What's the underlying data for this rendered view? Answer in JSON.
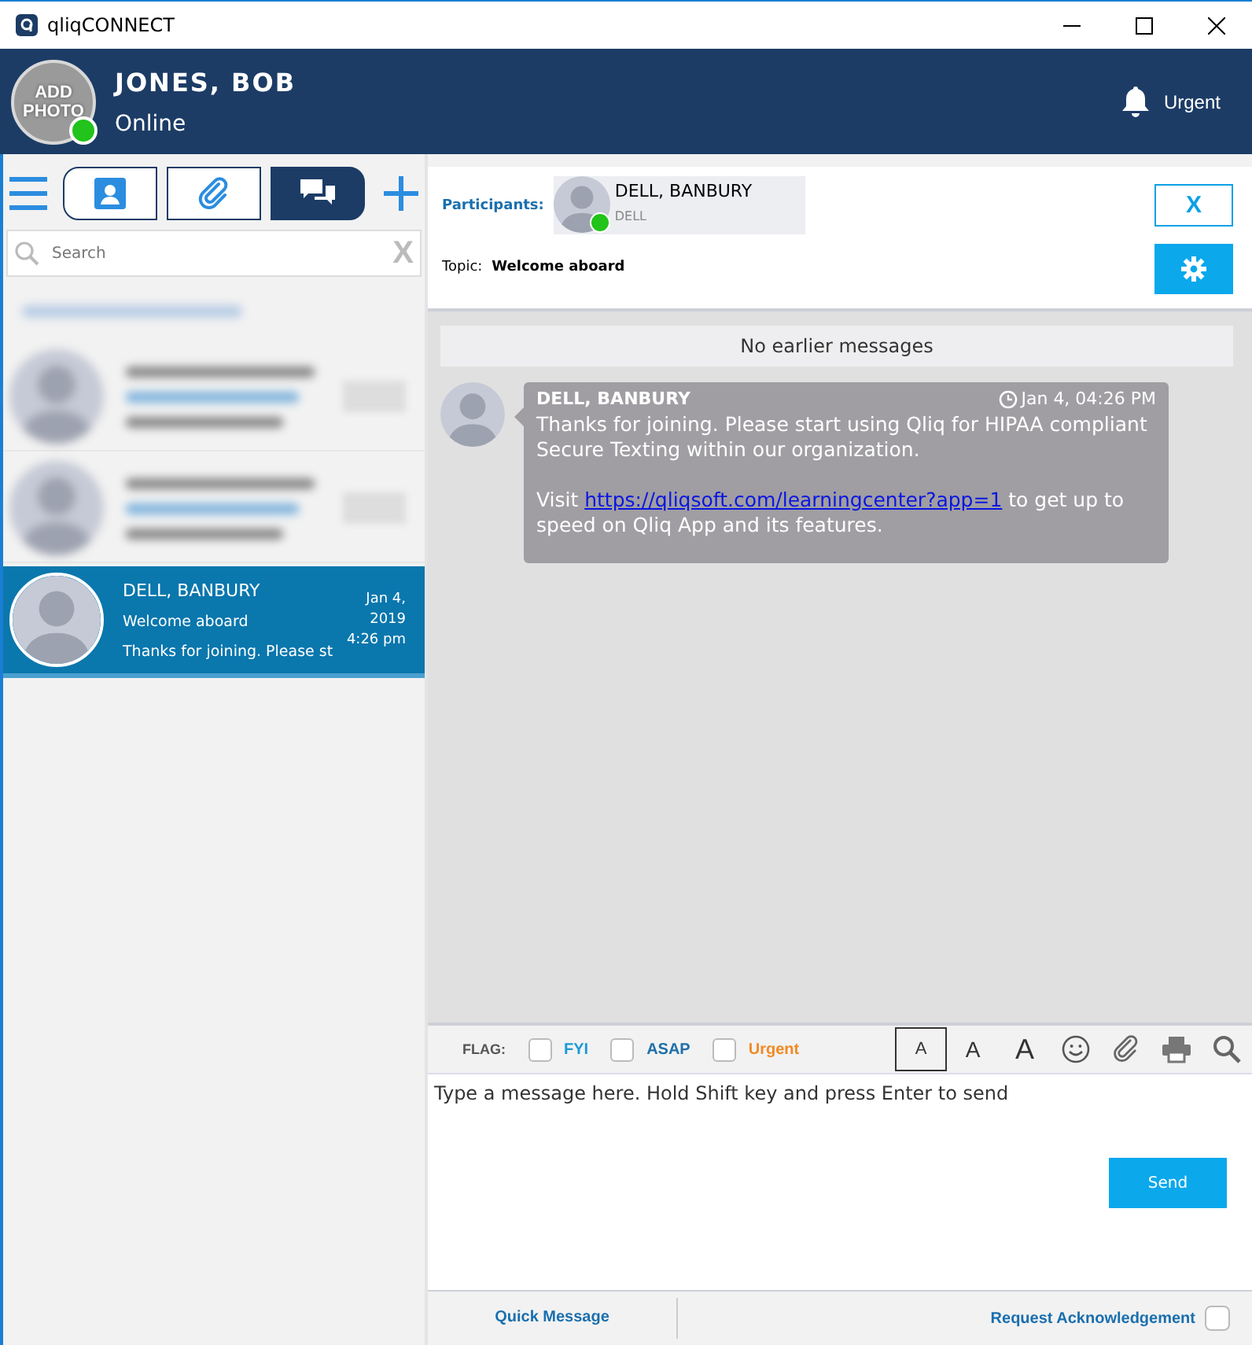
{
  "window": {
    "title": "qliqCONNECT"
  },
  "user": {
    "photo_label": "ADD PHOTO",
    "name": "JONES, BOB",
    "status": "Online",
    "online": true
  },
  "alert": {
    "label": "Urgent"
  },
  "sidebar": {
    "tabs": [
      {
        "kind": "contacts",
        "selected": false
      },
      {
        "kind": "attachments",
        "selected": false
      },
      {
        "kind": "chats",
        "selected": true
      }
    ],
    "search": {
      "placeholder": "Search",
      "clear": "X"
    },
    "conversations": [
      {
        "kind": "blurred",
        "selected": false
      },
      {
        "kind": "blurred",
        "selected": false
      },
      {
        "kind": "normal",
        "name": "DELL, BANBURY",
        "topic": "Welcome aboard",
        "preview": "Thanks for joining. Please st",
        "date": "Jan 4, 2019",
        "time": "4:26 pm",
        "selected": true
      }
    ]
  },
  "chat": {
    "participants_label": "Participants:",
    "participant": {
      "name": "DELL, BANBURY",
      "detail": "DELL",
      "online": true
    },
    "topic_label": "Topic:",
    "topic": "Welcome aboard",
    "close": "X",
    "notice": "No earlier messages",
    "messages": [
      {
        "sender": "DELL, BANBURY",
        "time": "Jan 4, 04:26 PM",
        "text": "Thanks for joining. Please start using Qliq for HIPAA compliant Secure Texting within our organization.",
        "link_before": "Visit ",
        "link": "https://qliqsoft.com/learningcenter?app=1",
        "link_after": " to get up to speed on Qliq App and its features."
      }
    ]
  },
  "composer": {
    "flag_label": "FLAG:",
    "flags": [
      {
        "label": "FYI",
        "color": "#1a9ad6",
        "checked": false
      },
      {
        "label": "ASAP",
        "color": "#1f6fa8",
        "checked": false
      },
      {
        "label": "Urgent",
        "color": "#f08a24",
        "checked": false
      }
    ],
    "font_sizes": [
      {
        "kind": "small",
        "label": "A",
        "selected": true
      },
      {
        "kind": "medium",
        "label": "A",
        "selected": false
      },
      {
        "kind": "large",
        "label": "A",
        "selected": false
      }
    ],
    "placeholder": "Type a message here. Hold Shift key and press Enter to send",
    "send": "Send"
  },
  "footer": {
    "quick_message": "Quick Message",
    "acknowledge": "Request Acknowledgement",
    "acknowledge_checked": false
  }
}
